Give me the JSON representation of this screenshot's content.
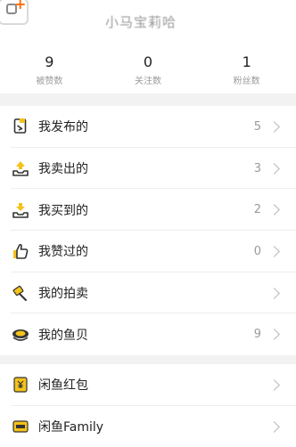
{
  "header": {
    "username": "小马宝莉哈"
  },
  "stats": [
    {
      "value": "9",
      "label": "被赞数"
    },
    {
      "value": "0",
      "label": "关注数"
    },
    {
      "value": "1",
      "label": "粉丝数"
    }
  ],
  "menu1": [
    {
      "label": "我发布的",
      "count": "5",
      "icon": "document-icon"
    },
    {
      "label": "我卖出的",
      "count": "3",
      "icon": "upload-tray-icon"
    },
    {
      "label": "我买到的",
      "count": "2",
      "icon": "download-tray-icon"
    },
    {
      "label": "我赞过的",
      "count": "0",
      "icon": "thumbs-up-icon"
    },
    {
      "label": "我的拍卖",
      "count": "",
      "icon": "auction-hammer-icon"
    },
    {
      "label": "我的鱼贝",
      "count": "9",
      "icon": "shell-icon"
    }
  ],
  "menu2": [
    {
      "label": "闲鱼红包",
      "count": "",
      "icon": "red-envelope-icon"
    },
    {
      "label": "闲鱼Family",
      "count": "",
      "icon": "family-card-icon"
    }
  ],
  "colors": {
    "accent": "#ff6a00",
    "iconYellow": "#f4c21a",
    "iconDark": "#333333",
    "muted": "#9a9a9a"
  }
}
